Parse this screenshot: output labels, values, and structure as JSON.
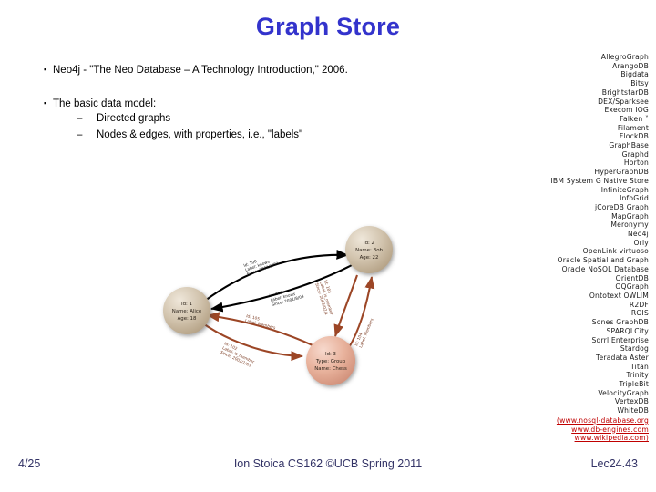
{
  "slide": {
    "title": "Graph Store"
  },
  "body": {
    "bullet1": "Neo4j - \"The Neo Database – A Technology Introduction,\" 2006.",
    "bullet2": "The basic data model:",
    "sub1": "Directed graphs",
    "sub2": "Nodes & edges, with properties, i.e., \"labels\""
  },
  "products": {
    "items": [
      "AllegroGraph",
      "ArangoDB",
      "Bigdata",
      "Bitsy",
      "BrightstarDB",
      "DEX/Sparksee",
      "Execom IOG",
      "Falken ˅",
      "Filament",
      "FlockDB",
      "GraphBase",
      "Graphd",
      "Horton",
      "HyperGraphDB",
      "IBM System G Native Store",
      "InfiniteGraph",
      "InfoGrid",
      "jCoreDB Graph",
      "MapGraph",
      "Meronymy",
      "Neo4j",
      "Orly",
      "OpenLink virtuoso",
      "Oracle Spatial and Graph",
      "Oracle NoSQL Database",
      "OrientDB",
      "OQGraph",
      "Ontotext OWLIM",
      "R2DF",
      "ROIS",
      "Sones GraphDB",
      "SPARQLCity",
      "Sqrrl Enterprise",
      "Stardog",
      "Teradata Aster",
      "Titan",
      "Trinity",
      "TripleBit",
      "VelocityGraph",
      "VertexDB",
      "WhiteDB"
    ],
    "links": [
      "(www.nosql-database.org",
      "www.db-engines.com",
      "www.wikipedia.com)"
    ],
    "link_color": "#c00000"
  },
  "graph": {
    "nodes": [
      {
        "id": "node-1",
        "line1": "Id: 1",
        "line2": "Name: Alice",
        "line3": "Age: 18",
        "color": "#c9bba6"
      },
      {
        "id": "node-2",
        "line1": "Id: 2",
        "line2": "Name: Bob",
        "line3": "Age: 22",
        "color": "#c9bba6"
      },
      {
        "id": "node-3",
        "line1": "Id: 3",
        "line2": "Type: Group",
        "line3": "Name: Chess",
        "color": "#e3ab96"
      }
    ],
    "edges": [
      {
        "id": "edge-100",
        "l1": "Id: 100",
        "l2": "Label: knows",
        "l3": "Since: 2001/1/03",
        "color": "#000000"
      },
      {
        "id": "edge-101",
        "l1": "Id: 101",
        "l2": "Label: knows",
        "l3": "Since: 2001/8/04",
        "color": "#000000"
      },
      {
        "id": "edge-102",
        "l1": "Id: 102",
        "l2": "Label: is_member",
        "l3": "Since: 2002/1/03",
        "color": "#a0522d"
      },
      {
        "id": "edge-103",
        "l1": "Id: 103",
        "l2": "Label: is_member",
        "l3": "Since: 2003/02/1",
        "color": "#a0522d"
      },
      {
        "id": "edge-104",
        "l1": "Id: 104",
        "l2": "Label: Members",
        "l3": "",
        "color": "#a0522d"
      },
      {
        "id": "edge-105",
        "l1": "Id: 105",
        "l2": "Label: Members",
        "l3": "",
        "color": "#a0522d"
      }
    ]
  },
  "footer": {
    "slide_number": "4/25",
    "center": "Ion Stoica CS162 ©UCB Spring 2011",
    "lecture_id": "Lec24.43"
  }
}
